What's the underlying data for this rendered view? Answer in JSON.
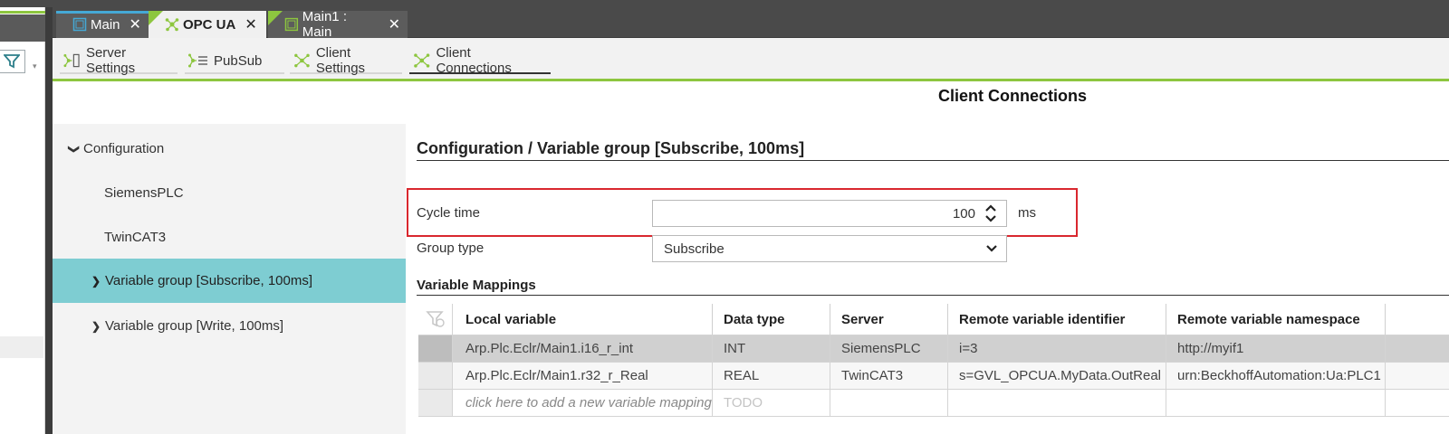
{
  "tabs": [
    {
      "label": "Main",
      "close": "✕",
      "active": false
    },
    {
      "label": "OPC UA",
      "close": "✕",
      "active": true
    },
    {
      "label": "Main1 : Main",
      "close": "✕",
      "active": false
    }
  ],
  "toolbar": {
    "items": [
      {
        "label": "Server Settings"
      },
      {
        "label": "PubSub"
      },
      {
        "label": "Client Settings"
      },
      {
        "label": "Client Connections",
        "active": true
      }
    ]
  },
  "page_title": "Client Connections",
  "tree": {
    "items": [
      {
        "label": "Configuration",
        "chevron": "❯",
        "expanded": true
      },
      {
        "label": "SiemensPLC"
      },
      {
        "label": "TwinCAT3"
      },
      {
        "label": "Variable group [Subscribe, 100ms]",
        "chevron": "❯",
        "selected": true
      },
      {
        "label": "Variable group [Write, 100ms]",
        "chevron": "❯"
      }
    ]
  },
  "section_title": "Configuration / Variable group [Subscribe, 100ms]",
  "form": {
    "cycle_time_label": "Cycle time",
    "cycle_time_value": "100",
    "cycle_time_unit": "ms",
    "group_type_label": "Group type",
    "group_type_value": "Subscribe"
  },
  "mappings_title": "Variable Mappings",
  "table": {
    "columns": [
      "Local variable",
      "Data type",
      "Server",
      "Remote variable identifier",
      "Remote variable namespace"
    ],
    "rows": [
      [
        "Arp.Plc.Eclr/Main1.i16_r_int",
        "INT",
        "SiemensPLC",
        "i=3",
        "http://myif1"
      ],
      [
        "Arp.Plc.Eclr/Main1.r32_r_Real",
        "REAL",
        "TwinCAT3",
        "s=GVL_OPCUA.MyData.OutReal",
        "urn:BeckhoffAutomation:Ua:PLC1"
      ]
    ],
    "new_row_hint": "click here to add a new variable mapping",
    "new_row_type": "TODO"
  },
  "colors": {
    "accent_green": "#8dc63f",
    "selection_teal": "#7ecdd2",
    "highlight_red": "#d9272e"
  }
}
